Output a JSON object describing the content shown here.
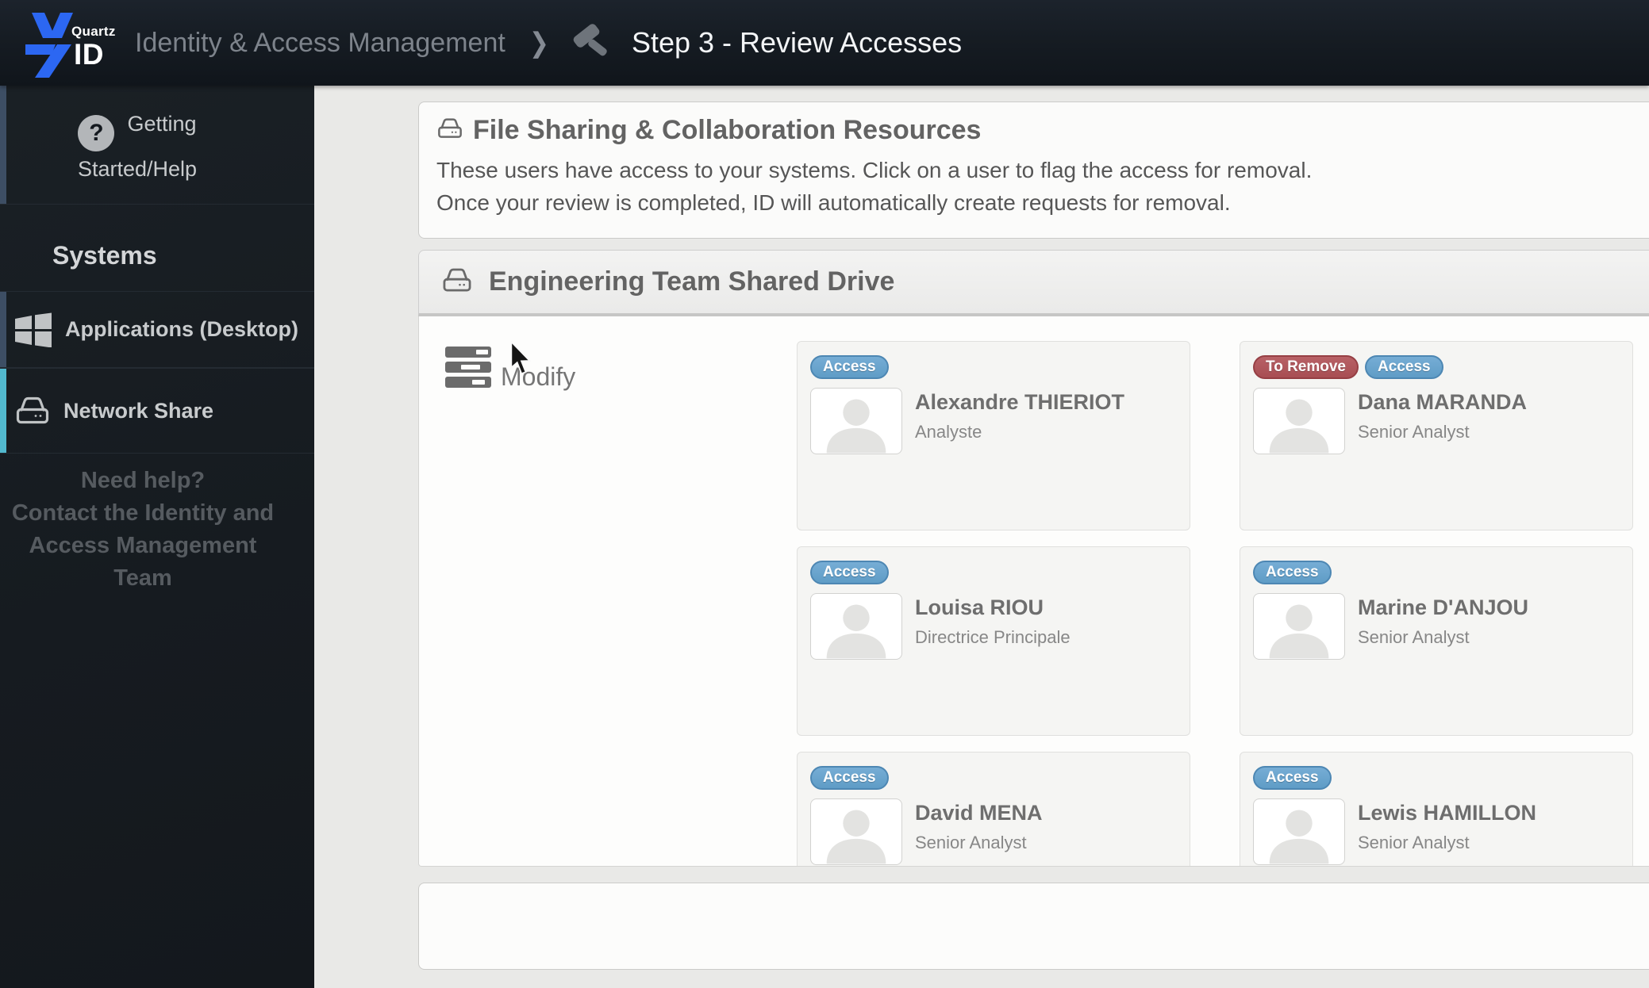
{
  "navbar": {
    "brand_top": "Quartz",
    "brand_bottom": "ID",
    "breadcrumb_parent": "Identity & Access Management",
    "page_title": "Step 3 - Review Accesses"
  },
  "sidebar": {
    "help_item_label": "Getting Started/Help",
    "section_title": "Systems",
    "items": [
      {
        "label": "Applications (Desktop)",
        "icon": "windows-icon",
        "active": false
      },
      {
        "label": "Network Share",
        "icon": "network-drive-icon",
        "active": true
      }
    ],
    "help_note_line1": "Need help?",
    "help_note_line2": "Contact the Identity and Access Management Team"
  },
  "main": {
    "intro_panel": {
      "title": "File Sharing & Collaboration Resources",
      "description_line1": "These users have access to your systems. Click on a user to flag the access for removal.",
      "description_line2": "Once your review is completed, ID will automatically create requests for removal."
    },
    "system_panel": {
      "title": "Engineering Team Shared Drive",
      "group_label": "Modify",
      "badge_styles": {
        "Access": "access",
        "To Remove": "remove"
      },
      "users": [
        {
          "name": "Alexandre THIERIOT",
          "title": "Analyste",
          "badges": [
            "Access"
          ]
        },
        {
          "name": "Dana MARANDA",
          "title": "Senior Analyst",
          "badges": [
            "To Remove",
            "Access"
          ]
        },
        {
          "name": "Louisa RIOU",
          "title": "Directrice Principale",
          "badges": [
            "Access"
          ]
        },
        {
          "name": "Marine D'ANJOU",
          "title": "Senior Analyst",
          "badges": [
            "Access"
          ]
        },
        {
          "name": "David MENA",
          "title": "Senior Analyst",
          "badges": [
            "Access"
          ]
        },
        {
          "name": "Lewis HAMILLON",
          "title": "Senior Analyst",
          "badges": [
            "Access"
          ]
        }
      ]
    }
  },
  "colors": {
    "navbar_bg": "#161c23",
    "sidebar_bg": "#171c21",
    "page_bg": "#e9e9e7",
    "accent_active": "#52b9cf",
    "accent_inactive": "#3d4e64",
    "badge_access": "#67a2cc",
    "badge_remove": "#b0565b",
    "brand_blue": "#2c67f2"
  }
}
